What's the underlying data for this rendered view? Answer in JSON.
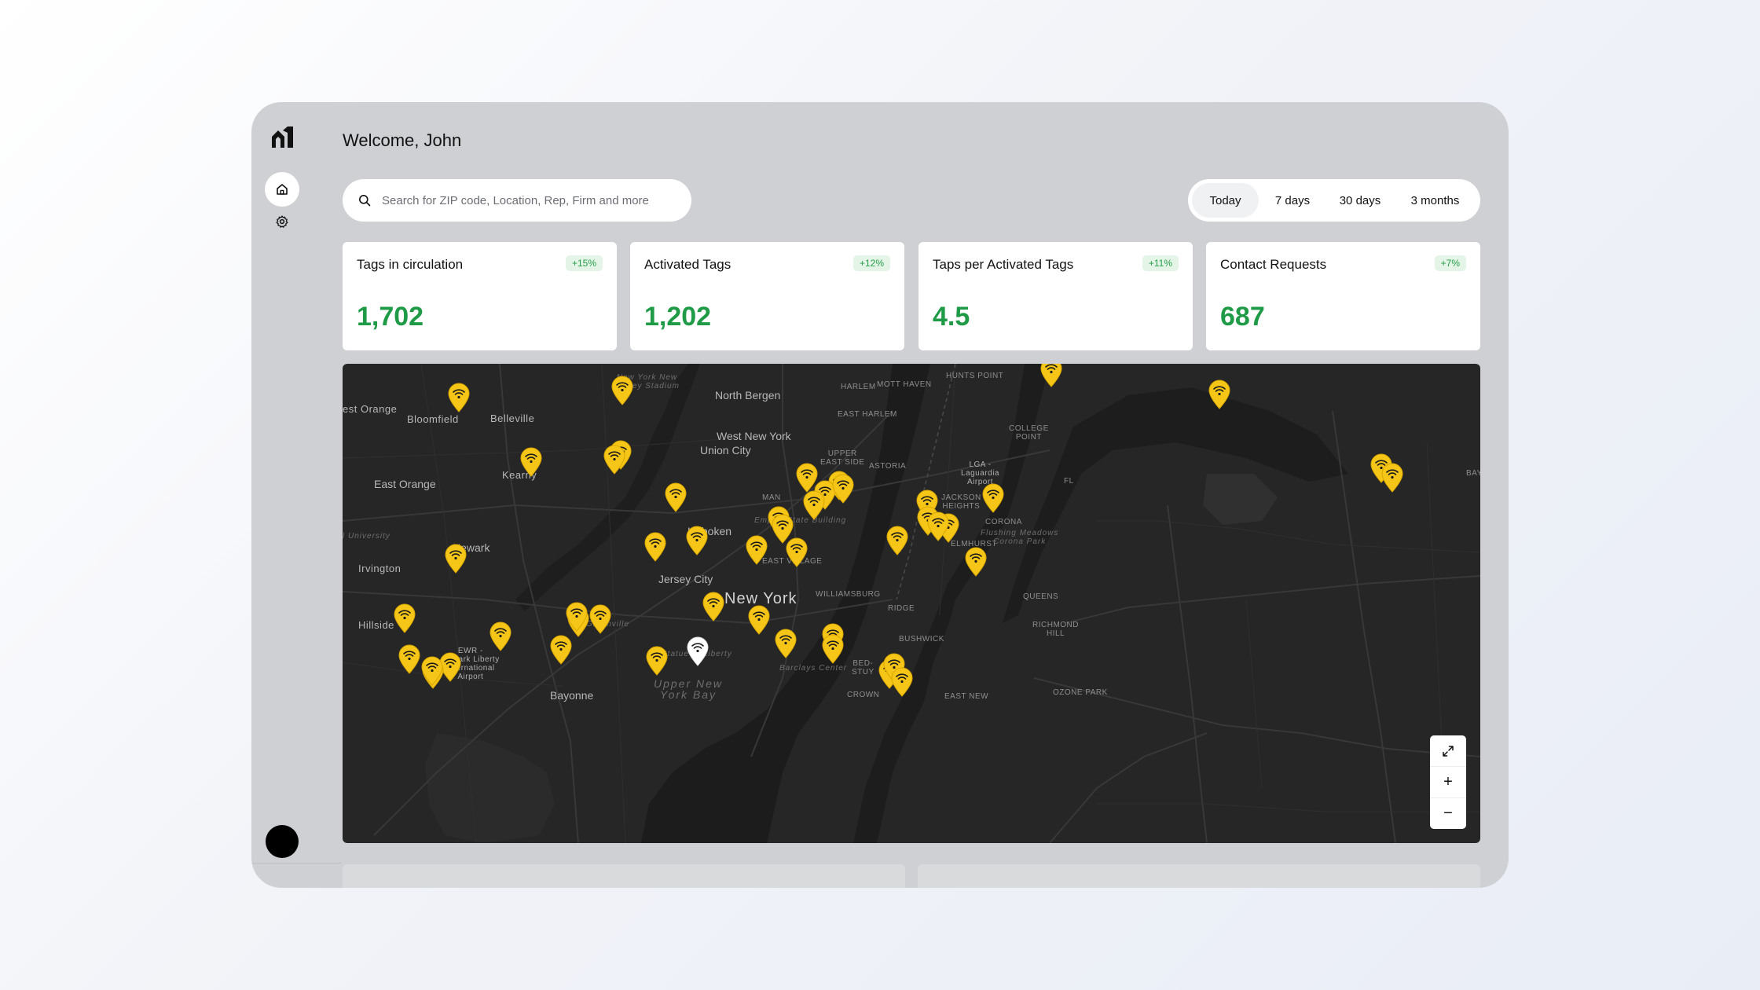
{
  "header": {
    "welcome": "Welcome, John"
  },
  "search": {
    "placeholder": "Search for ZIP code, Location, Rep, Firm and more",
    "value": ""
  },
  "range": {
    "options": [
      "Today",
      "7 days",
      "30 days",
      "3 months"
    ],
    "selected": "Today"
  },
  "stats": [
    {
      "title": "Tags in circulation",
      "badge": "+15%",
      "value": "1,702"
    },
    {
      "title": "Activated Tags",
      "badge": "+12%",
      "value": "1,202"
    },
    {
      "title": "Taps per Activated Tags",
      "badge": "+11%",
      "value": "4.5"
    },
    {
      "title": "Contact Requests",
      "badge": "+7%",
      "value": "687"
    }
  ],
  "map": {
    "labels": {
      "north_bergen": "North Bergen",
      "west_ny": "West New York",
      "union_city": "Union City",
      "hoboken": "Hoboken",
      "jersey_city": "Jersey City",
      "new_york": "New York",
      "newark": "Newark",
      "east_orange": "East Orange",
      "west_orange": "est Orange",
      "bloomfield": "Bloomfield",
      "belleville": "Belleville",
      "kearny": "Kearny",
      "irvington": "Irvington",
      "hillside": "Hillside",
      "bayonne": "Bayonne",
      "harlem": "HARLEM",
      "mott_haven": "MOTT HAVEN",
      "hunts_point": "HUNTS POINT",
      "east_harlem": "EAST HARLEM",
      "upper_east_side": "UPPER\nEAST SIDE",
      "astoria": "ASTORIA",
      "college_point": "COLLEGE\nPOINT",
      "lga": "LGA -\nLaguardia\nAirport",
      "corona": "CORONA",
      "elmhurst": "ELMHURST",
      "flushing_park": "Flushing Meadows\nCorona Park",
      "queens": "QUEENS",
      "richmond_hill": "RICHMOND\nHILL",
      "bushwick": "BUSHWICK",
      "ridge": "RIDGE",
      "williamsburg": "WILLIAMSBURG",
      "east_village": "EAST VILLAGE",
      "empire_state": "Empire State Building",
      "barclays": "Barclays Center",
      "crown": "CROWN",
      "east_new": "EAST NEW",
      "ozone_park": "OZONE PARK",
      "ewr": "EWR -\nNewark Liberty\nInternational\nAirport",
      "statue": "Statue of Liberty",
      "upper_ny_bay": "Upper New\nYork Bay",
      "jets_stadium": "New York New\nJersey Stadium",
      "university": "l University",
      "greenville": "Greenville",
      "man": "MAN",
      "jackson_heights": "JACKSON\nHEIGHTS",
      "flushing": "FL",
      "bayside": "BAYS",
      "bed_stuy": "BED-\nSTUY"
    },
    "pin_color": "#f5c518",
    "pin_selected_color": "#ffffff",
    "pin_icon": "wifi-icon",
    "pin_count": 49
  },
  "zoom": {
    "expand_icon": "expand-icon",
    "in_label": "+",
    "out_label": "−"
  }
}
